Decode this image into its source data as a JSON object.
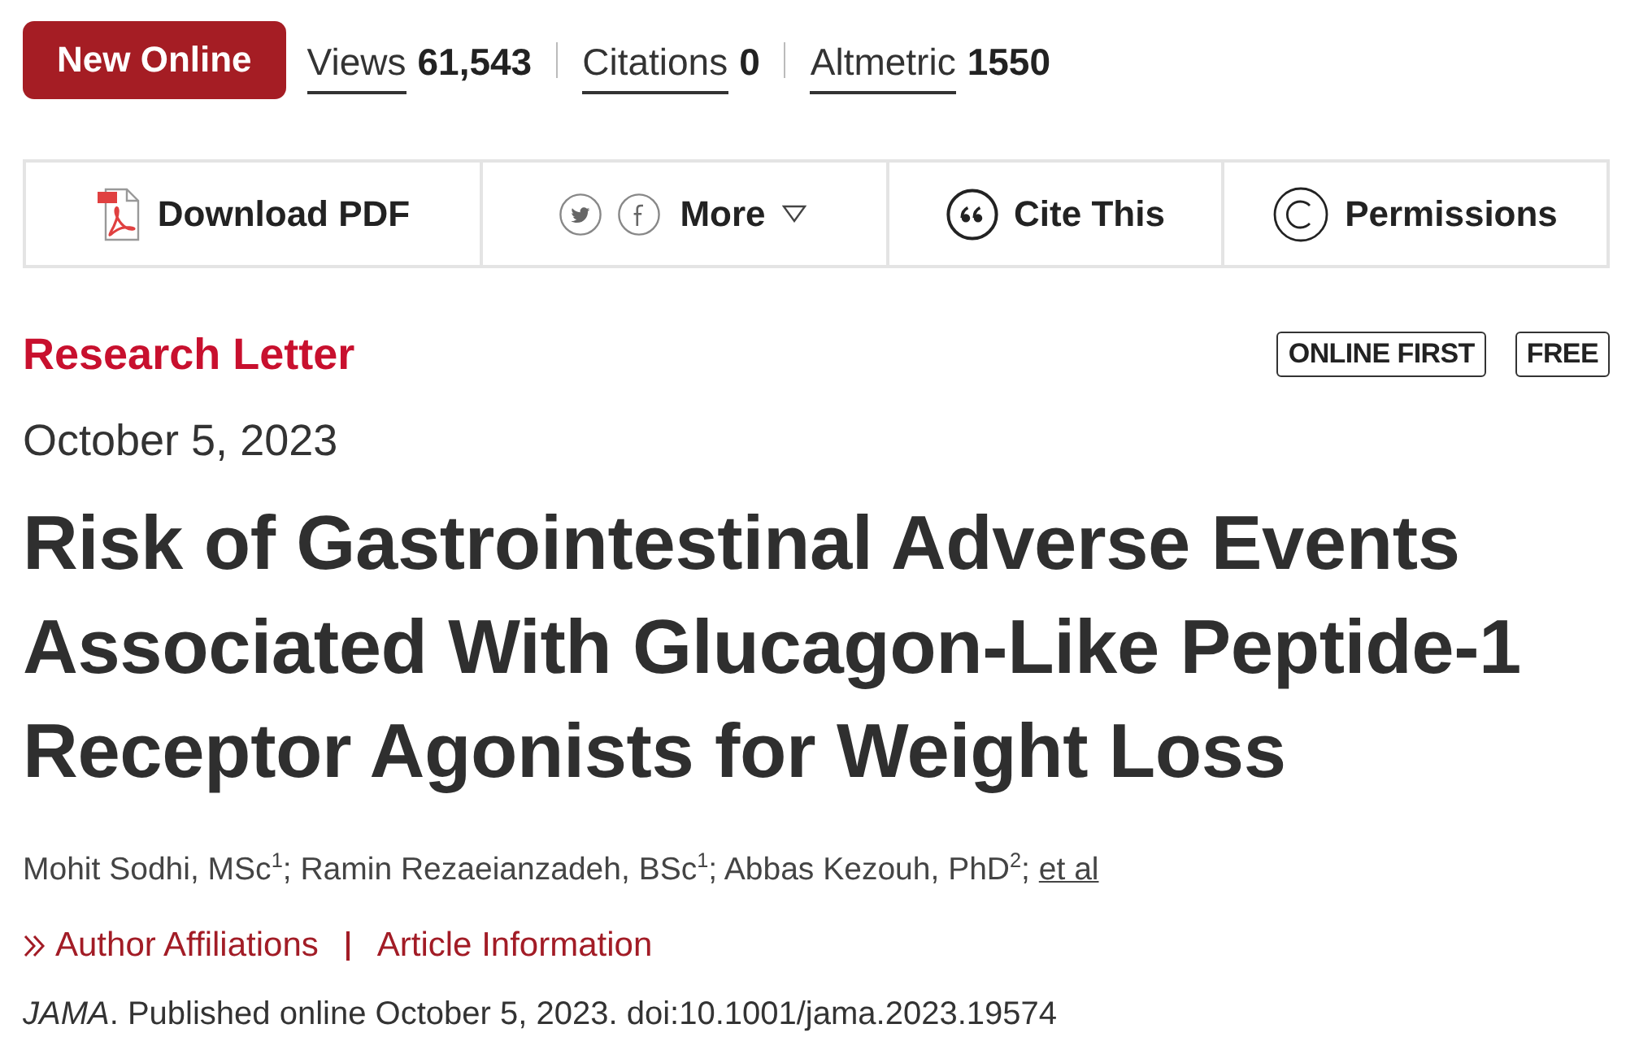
{
  "header": {
    "badge": "New Online",
    "metrics": [
      {
        "label": "Views",
        "value": "61,543"
      },
      {
        "label": "Citations",
        "value": "0"
      },
      {
        "label": "Altmetric",
        "value": "1550"
      }
    ]
  },
  "toolbar": [
    {
      "kind": "pdf",
      "label": "Download PDF"
    },
    {
      "kind": "share",
      "label": "More"
    },
    {
      "kind": "cite",
      "label": "Cite This"
    },
    {
      "kind": "permissions",
      "label": "Permissions"
    }
  ],
  "article": {
    "type": "Research Letter",
    "tags": [
      "ONLINE FIRST",
      "FREE"
    ],
    "date": "October 5, 2023",
    "title": "Risk of Gastrointestinal Adverse Events Associated With Glucagon-Like Peptide-1 Receptor Agonists for Weight Loss",
    "authors": "Mohit Sodhi, MSc$^{1}$; Ramin Rezaeianzadeh, BSc$^{1}$; Abbas Kezouh, PhD$^{2}$;",
    "authors_link": "et al",
    "links": [
      "Author Affiliations",
      "Article Information"
    ],
    "citation": "*JAMA*. Published online October 5, 2023. doi:10.1001/jama.2023.19574"
  }
}
